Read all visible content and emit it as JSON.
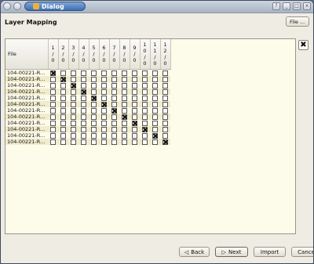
{
  "window": {
    "title": "Dialog"
  },
  "heading": "Layer Mapping",
  "file_button": {
    "label": "File ..."
  },
  "table": {
    "file_header": "File",
    "layer_headers": [
      "1/0",
      "2/0",
      "3/0",
      "4/0",
      "5/0",
      "6/0",
      "7/0",
      "8/0",
      "9/0",
      "10/0",
      "11/0",
      "12/0"
    ],
    "rows": [
      {
        "file": "104-00221-R...",
        "checked": 0
      },
      {
        "file": "104-00221-R...",
        "checked": 1
      },
      {
        "file": "104-00221-R...",
        "checked": 2
      },
      {
        "file": "104-00221-R...",
        "checked": 3
      },
      {
        "file": "104-00221-R...",
        "checked": 4
      },
      {
        "file": "104-00221-R...",
        "checked": 5
      },
      {
        "file": "104-00221-R...",
        "checked": 6
      },
      {
        "file": "104-00221-R...",
        "checked": 7
      },
      {
        "file": "104-00221-R...",
        "checked": 8
      },
      {
        "file": "104-00221-R...",
        "checked": 9
      },
      {
        "file": "104-00221-R...",
        "checked": 10
      },
      {
        "file": "104-00221-R...",
        "checked": 11
      }
    ]
  },
  "buttons": {
    "back": "Back",
    "next": "Next",
    "import": "Import",
    "cancel": "Cancel"
  },
  "colors": {
    "grid_bg": "#fdfbe9",
    "row_alt": "#f1ecce",
    "title_accent": "#3f6fae"
  }
}
